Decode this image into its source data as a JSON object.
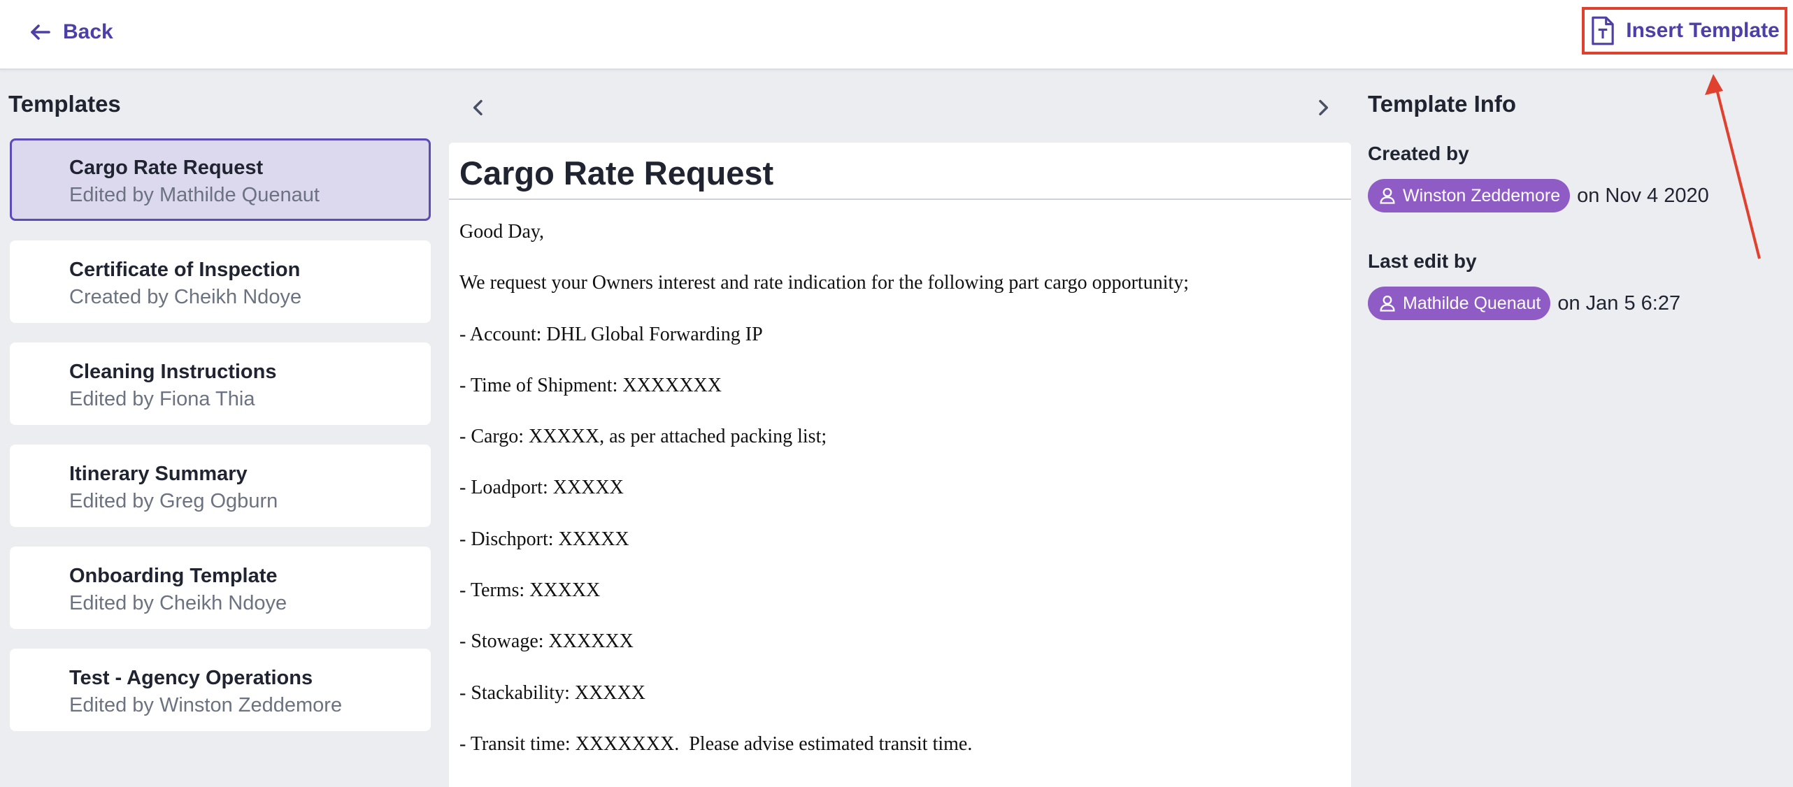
{
  "header": {
    "back_label": "Back",
    "insert_label": "Insert Template",
    "accent": "#4c3fa8",
    "annotation_color": "#e0412f"
  },
  "templates": {
    "title": "Templates",
    "items": [
      {
        "name": "Cargo Rate Request",
        "sub": "Edited by Mathilde Quenaut",
        "selected": true
      },
      {
        "name": "Certificate of Inspection",
        "sub": "Created by Cheikh Ndoye"
      },
      {
        "name": "Cleaning Instructions",
        "sub": "Edited by Fiona Thia"
      },
      {
        "name": "Itinerary Summary",
        "sub": "Edited by Greg Ogburn"
      },
      {
        "name": "Onboarding Template",
        "sub": "Edited by Cheikh Ndoye"
      },
      {
        "name": "Test - Agency Operations",
        "sub": "Edited by Winston Zeddemore"
      }
    ]
  },
  "document": {
    "title": "Cargo Rate Request",
    "lines": [
      "Good Day,",
      "We request your Owners interest and rate indication for the following part cargo opportunity;",
      "- Account: DHL Global Forwarding IP",
      "- Time of Shipment: XXXXXXX",
      "- Cargo: XXXXX, as per attached packing list;",
      "- Loadport: XXXXX",
      "- Dischport: XXXXX",
      "- Terms: XXXXX",
      "- Stowage: XXXXXX",
      "- Stackability: XXXXX",
      "- Transit time: XXXXXXX.  Please advise estimated transit time."
    ]
  },
  "info": {
    "title": "Template Info",
    "created_label": "Created by",
    "created_user": "Winston Zeddemore",
    "created_date": "on Nov 4 2020",
    "edited_label": "Last edit by",
    "edited_user": "Mathilde Quenaut",
    "edited_date": "on Jan 5 6:27",
    "chip_color": "#8f5cc6"
  }
}
